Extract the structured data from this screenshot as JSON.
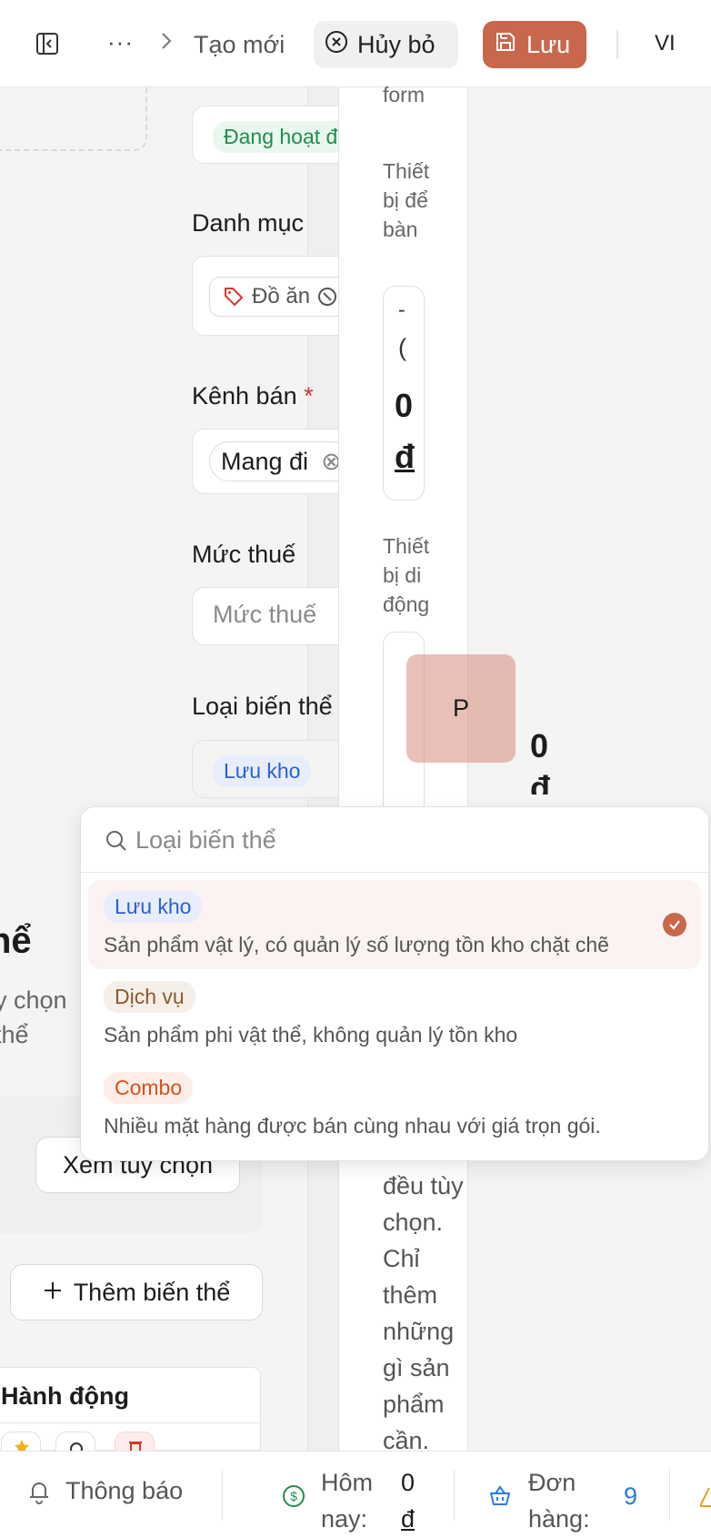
{
  "topbar": {
    "more": "···",
    "breadcrumb_current": "Tạo mới",
    "cancel_label": "Hủy bỏ",
    "save_label": "Lưu",
    "language": "VI"
  },
  "form": {
    "status_chip": "Đang hoạt động",
    "category_label": "Danh mục",
    "category_chip": "Đồ ăn",
    "channel_label": "Kênh bán",
    "channel_required": "*",
    "channel_chip": "Mang đi",
    "tax_label": "Mức thuế",
    "tax_placeholder": "Mức thuế",
    "variant_type_label": "Loại biến thể",
    "variant_type_value": "Lưu kho"
  },
  "preview_strip": {
    "form_word": "form",
    "desktop_label": "Thiết bị để bàn",
    "desktop_dash": "-",
    "desktop_partial": "(",
    "desktop_price_num": "0",
    "desktop_price_unit": "đ",
    "mobile_label": "Thiết bị di động",
    "mobile_overlay": "P",
    "right_price_num": "0",
    "right_price_unit": "đ",
    "long_text": "đều tùy chọn. Chỉ thêm những gì sản phẩm cần."
  },
  "left_panel": {
    "heading_partial": "hể",
    "sub_line1": "y chọn",
    "sub_line2": "thể",
    "view_options_button": "Xem tùy chọn",
    "add_variant_button": "Thêm biến thể",
    "table_header": "Hành động"
  },
  "dropdown": {
    "search_placeholder": "Loại biến thể",
    "options": [
      {
        "label": "Lưu kho",
        "description": "Sản phẩm vật lý, có quản lý số lượng tồn kho chặt chẽ",
        "selected": true,
        "chip_bg": "#e7edfb",
        "chip_color": "#2a5fd3"
      },
      {
        "label": "Dịch vụ",
        "description": "Sản phẩm phi vật thể, không quản lý tồn kho",
        "selected": false,
        "chip_bg": "#f4efe9",
        "chip_color": "#8a5a2e"
      },
      {
        "label": "Combo",
        "description": "Nhiều mặt hàng được bán cùng nhau với giá trọn gói.",
        "selected": false,
        "chip_bg": "#fdeee8",
        "chip_color": "#d4531f"
      }
    ]
  },
  "bottombar": {
    "notifications_label": "Thông báo",
    "today_label_line1": "Hôm",
    "today_label_line2": "nay:",
    "today_value_num": "0",
    "today_value_unit": "đ",
    "orders_label_line1": "Đơn",
    "orders_label_line2": "hàng:",
    "orders_value": "9"
  },
  "colors": {
    "accent": "#c9674d",
    "status_green": "#1e8f4a",
    "info_blue": "#2a7be4",
    "required_red": "#d9342b"
  }
}
